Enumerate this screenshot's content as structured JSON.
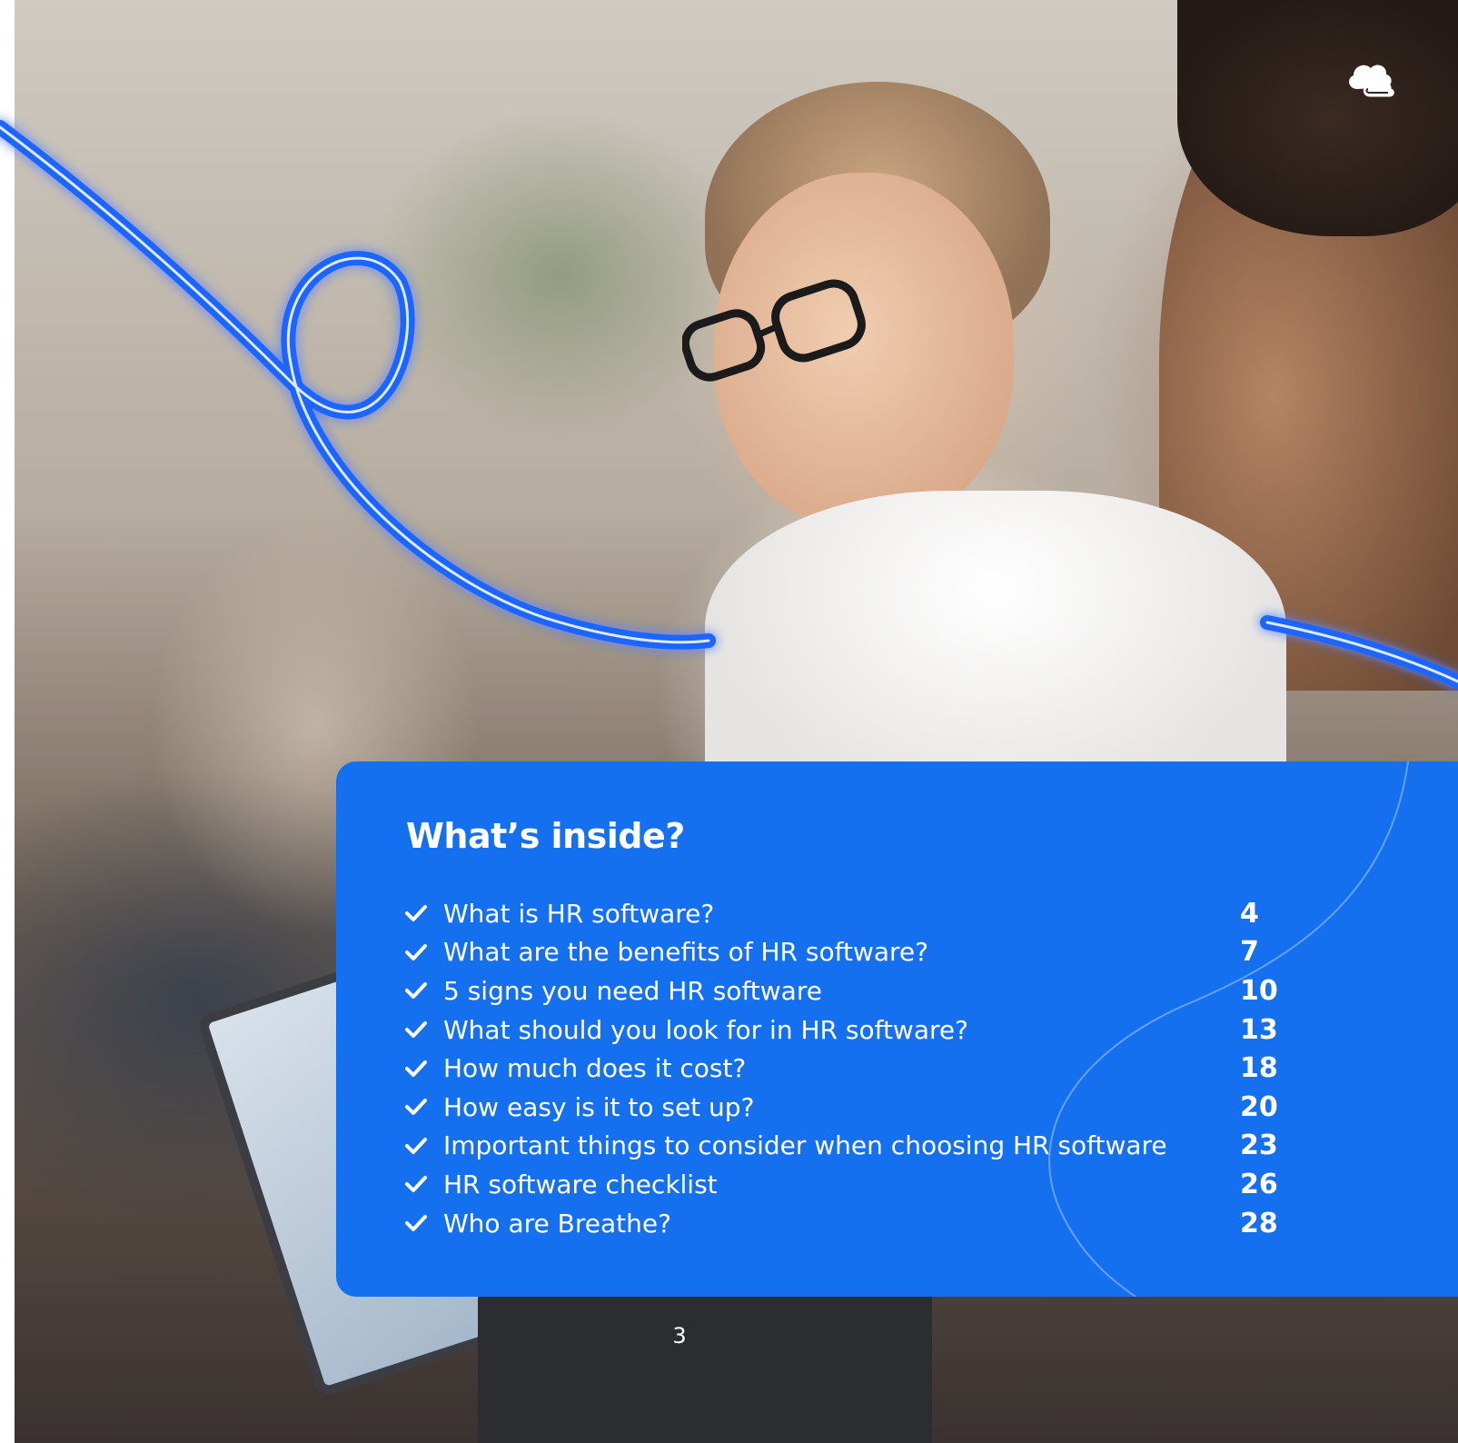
{
  "toc": {
    "title": "What’s inside?",
    "items": [
      {
        "label": "What is HR software?",
        "page": "4"
      },
      {
        "label": "What are the benefits of HR software?",
        "page": "7"
      },
      {
        "label": "5 signs you need HR software",
        "page": "10"
      },
      {
        "label": "What should you look for in HR software?",
        "page": "13"
      },
      {
        "label": "How much does it cost?",
        "page": "18"
      },
      {
        "label": "How easy is it to set up?",
        "page": "20"
      },
      {
        "label": "Important things to consider when choosing HR software",
        "page": "23"
      },
      {
        "label": "HR software checklist",
        "page": "26"
      },
      {
        "label": "Who are Breathe?",
        "page": "28"
      }
    ]
  },
  "footer": {
    "page_number": "3"
  },
  "icons": {
    "logo": "cloud-logo-icon",
    "bullet": "checkmark-icon"
  },
  "colors": {
    "panel_blue": "#1570ef",
    "swoosh_blue": "#1a66ff",
    "text": "#ffffff"
  }
}
